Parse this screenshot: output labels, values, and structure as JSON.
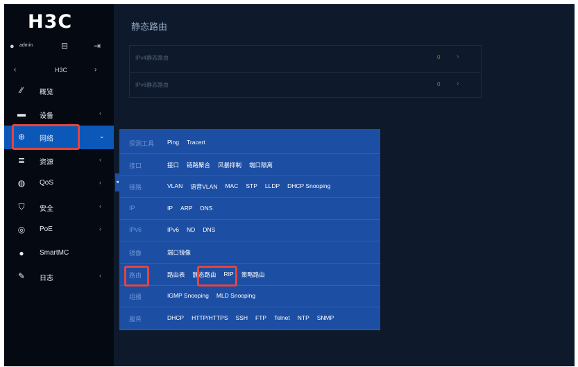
{
  "brand": {
    "logo": "H3C"
  },
  "user": {
    "name": "admin"
  },
  "device": {
    "name": "H3C"
  },
  "nav": [
    {
      "label": "概览",
      "icon": "dashboard-icon",
      "glyph": "⁄⁄",
      "chevron": ""
    },
    {
      "label": "设备",
      "icon": "device-icon",
      "glyph": "▬",
      "chevron": "‹"
    },
    {
      "label": "网络",
      "icon": "globe-icon",
      "glyph": "⊕",
      "chevron": "⌄"
    },
    {
      "label": "资源",
      "icon": "database-icon",
      "glyph": "≣",
      "chevron": "‹"
    },
    {
      "label": "QoS",
      "icon": "qos-icon",
      "glyph": "◍",
      "chevron": "‹"
    },
    {
      "label": "安全",
      "icon": "shield-icon",
      "glyph": "⛉",
      "chevron": "‹"
    },
    {
      "label": "PoE",
      "icon": "poe-icon",
      "glyph": "◎",
      "chevron": "‹"
    },
    {
      "label": "SmartMC",
      "icon": "smartmc-icon",
      "glyph": "●",
      "chevron": ""
    },
    {
      "label": "日志",
      "icon": "log-icon",
      "glyph": "✎",
      "chevron": "‹"
    }
  ],
  "main": {
    "title": "静态路由",
    "rows": [
      {
        "label": "IPv4静态路由",
        "count": "0",
        "arrow": "›"
      },
      {
        "label": "IPv6静态路由",
        "count": "0",
        "arrow": "›"
      }
    ]
  },
  "menu": {
    "rows": [
      {
        "category": "探测工具",
        "items": [
          "Ping",
          "Tracert"
        ]
      },
      {
        "category": "接口",
        "items": [
          "接口",
          "链路聚合",
          "风暴抑制",
          "端口隔离"
        ]
      },
      {
        "category": "链路",
        "items": [
          "VLAN",
          "语音VLAN",
          "MAC",
          "STP",
          "LLDP",
          "DHCP Snooping"
        ]
      },
      {
        "category": "IP",
        "items": [
          "IP",
          "ARP",
          "DNS"
        ]
      },
      {
        "category": "IPv6",
        "items": [
          "IPv6",
          "ND",
          "DNS"
        ]
      },
      {
        "category": "镜像",
        "items": [
          "端口镜像"
        ]
      },
      {
        "category": "路由",
        "items": [
          "路由表",
          "静态路由",
          "RIP",
          "策略路由"
        ]
      },
      {
        "category": "组播",
        "items": [
          "IGMP Snooping",
          "MLD Snooping"
        ]
      },
      {
        "category": "服务",
        "items": [
          "DHCP",
          "HTTP/HTTPS",
          "SSH",
          "FTP",
          "Telnet",
          "NTP",
          "SNMP"
        ]
      }
    ]
  },
  "colors": {
    "accent": "#0c58b8",
    "menu_bg": "#1c4ea3",
    "highlight": "#e5453f"
  }
}
